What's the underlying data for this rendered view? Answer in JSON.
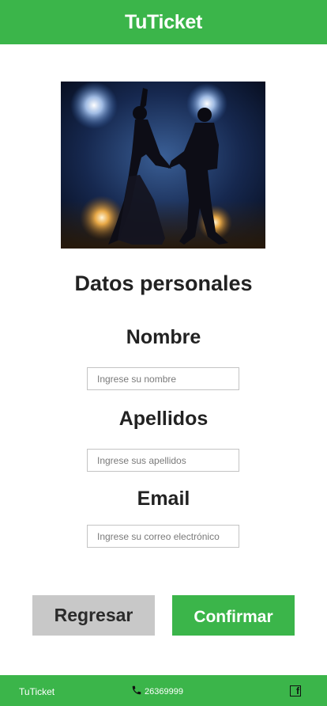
{
  "header": {
    "title": "TuTicket"
  },
  "hero": {
    "image": "dancing-couple-photo"
  },
  "form": {
    "title": "Datos personales",
    "nombre": {
      "label": "Nombre",
      "placeholder": "Ingrese su nombre",
      "value": ""
    },
    "apellidos": {
      "label": "Apellidos",
      "placeholder": "Ingrese sus apellidos",
      "value": ""
    },
    "email": {
      "label": "Email",
      "placeholder": "Ingrese su correo electrónico",
      "value": ""
    }
  },
  "actions": {
    "back_label": "Regresar",
    "confirm_label": "Confirmar"
  },
  "footer": {
    "brand": "TuTicket",
    "phone": "26369999",
    "phone_icon": "phone-icon",
    "social_icon": "facebook-icon",
    "social_glyph": "f"
  },
  "colors": {
    "accent": "#3bb54a",
    "secondary_button": "#c8c8c8",
    "text": "#222222"
  }
}
